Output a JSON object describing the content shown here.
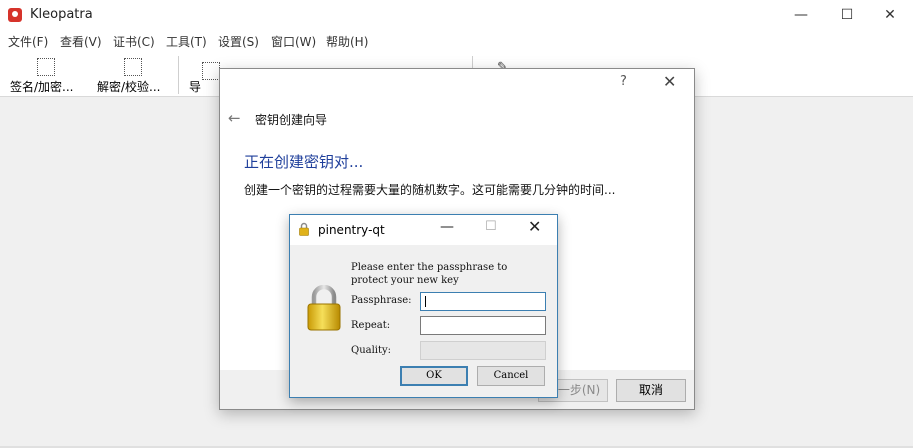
{
  "app": {
    "title": "Kleopatra",
    "window_controls": {
      "minimize": "—",
      "maximize": "☐",
      "close": "✕"
    }
  },
  "menu": [
    "文件(F)",
    "查看(V)",
    "证书(C)",
    "工具(T)",
    "设置(S)",
    "窗口(W)",
    "帮助(H)"
  ],
  "toolbar": {
    "sign_encrypt": "签名/加密...",
    "decrypt_verify": "解密/校验...",
    "import": "导入..."
  },
  "wizard": {
    "help": "?",
    "close": "✕",
    "back": "←",
    "title": "密钥创建向导",
    "heading": "正在创建密钥对...",
    "description": "创建一个密钥的过程需要大量的随机数字。这可能需要几分钟的时间...",
    "next_button": "下一步(N)",
    "cancel_button": "取消"
  },
  "pinentry": {
    "title": "pinentry-qt",
    "minimize": "—",
    "maximize": "☐",
    "close": "✕",
    "prompt_line1": "Please enter the passphrase to",
    "prompt_line2": "protect your new key",
    "passphrase_label": "Passphrase:",
    "repeat_label": "Repeat:",
    "quality_label": "Quality:",
    "ok_button": "OK",
    "cancel_button": "Cancel"
  }
}
